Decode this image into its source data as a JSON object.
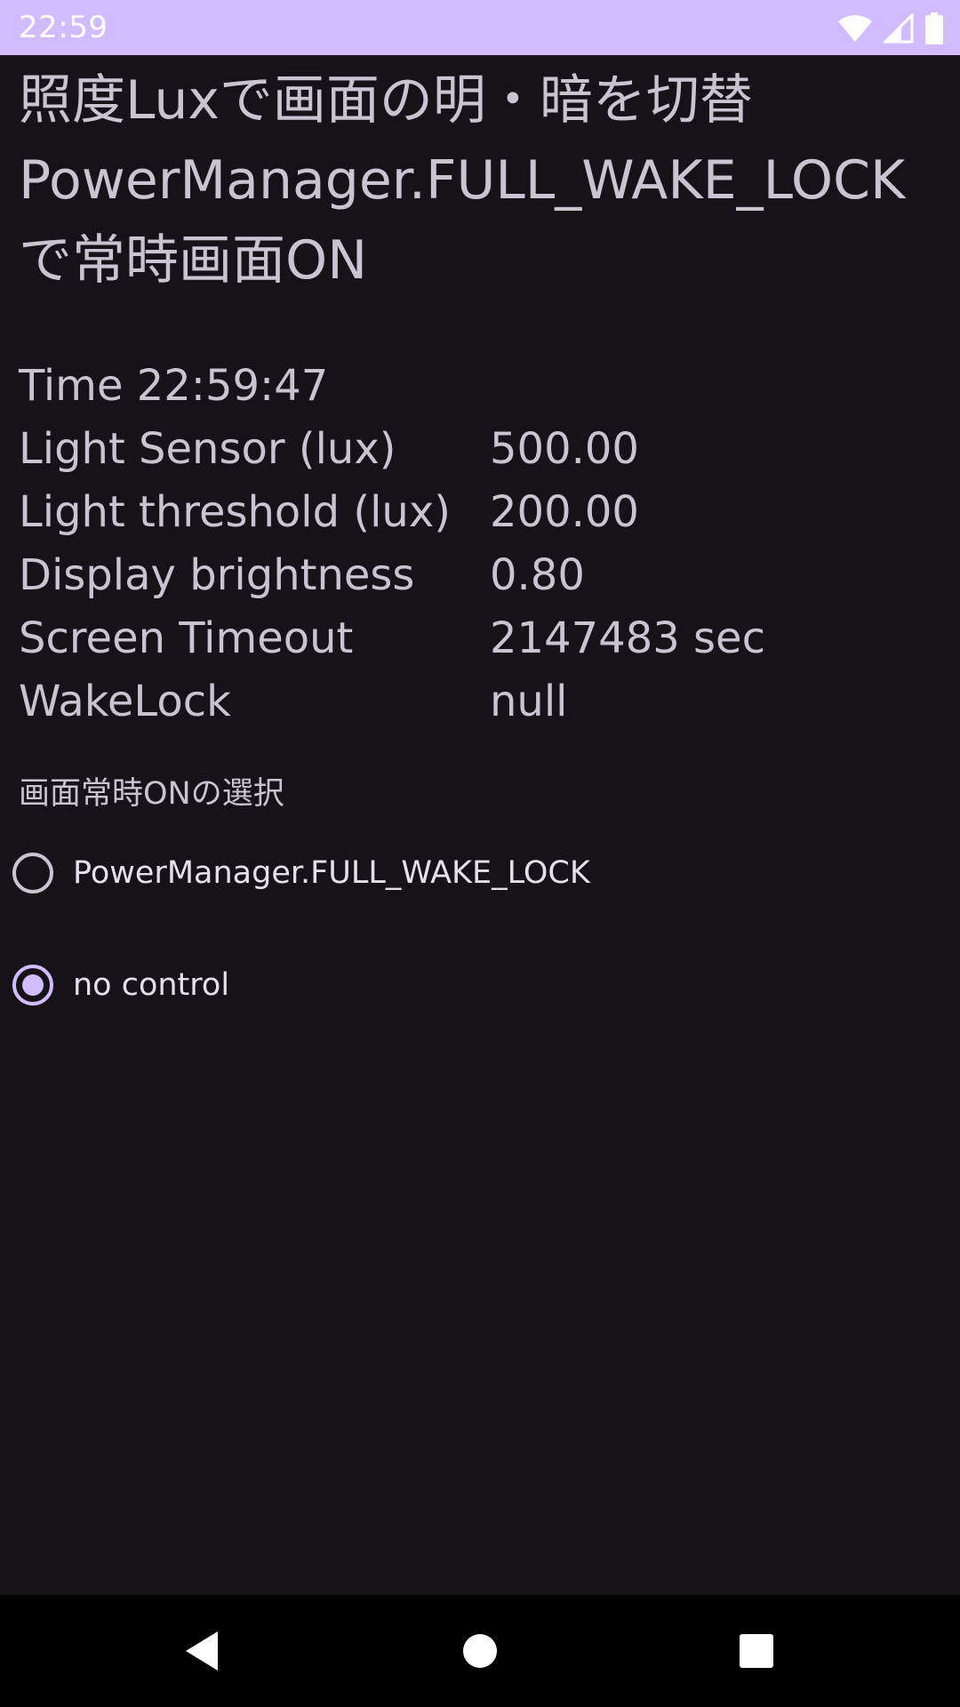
{
  "status_bar": {
    "time": "22:59",
    "icons": [
      "wifi-icon",
      "cell-signal-icon",
      "battery-icon"
    ],
    "background": "#d0bcff"
  },
  "app": {
    "title": "照度Luxで画面の明・暗を切替\nPowerManager.FULL_WAKE_LOCK\nで常時画面ON",
    "time_label": "Time 22:59:47",
    "rows": [
      {
        "label": "Light Sensor (lux)",
        "value": "500.00"
      },
      {
        "label": "Light threshold (lux)",
        "value": "200.00"
      },
      {
        "label": "Display brightness",
        "value": "0.80"
      },
      {
        "label": "Screen Timeout",
        "value": "2147483 sec"
      },
      {
        "label": "WakeLock",
        "value": "null"
      }
    ],
    "section_label": "画面常時ONの選択",
    "radio_options": [
      {
        "label": "PowerManager.FULL_WAKE_LOCK",
        "checked": false
      },
      {
        "label": "no control",
        "checked": true
      }
    ]
  },
  "nav_bar": {
    "buttons": [
      "back-icon",
      "home-icon",
      "recents-icon"
    ]
  },
  "colors": {
    "background": "#151218",
    "text": "#cac4d0",
    "accent": "#d0bcff"
  }
}
